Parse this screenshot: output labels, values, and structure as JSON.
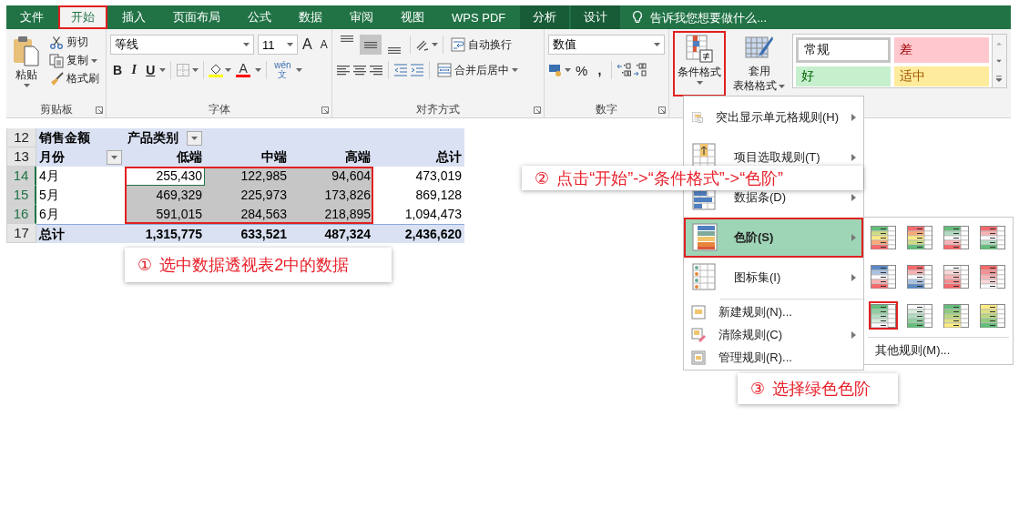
{
  "tabs": [
    {
      "label": "文件",
      "selected": false,
      "kind": "normal"
    },
    {
      "label": "开始",
      "selected": true,
      "kind": "normal"
    },
    {
      "label": "插入",
      "selected": false,
      "kind": "normal"
    },
    {
      "label": "页面布局",
      "selected": false,
      "kind": "normal"
    },
    {
      "label": "公式",
      "selected": false,
      "kind": "normal"
    },
    {
      "label": "数据",
      "selected": false,
      "kind": "normal"
    },
    {
      "label": "审阅",
      "selected": false,
      "kind": "normal"
    },
    {
      "label": "视图",
      "selected": false,
      "kind": "normal"
    },
    {
      "label": "WPS PDF",
      "selected": false,
      "kind": "normal"
    },
    {
      "label": "分析",
      "selected": false,
      "kind": "contextual"
    },
    {
      "label": "设计",
      "selected": false,
      "kind": "contextual"
    }
  ],
  "tell_me": {
    "placeholder": "告诉我您想要做什么..."
  },
  "ribbon": {
    "clipboard": {
      "label": "剪贴板",
      "paste": "粘贴",
      "cut": "剪切",
      "copy": "复制",
      "format_painter": "格式刷"
    },
    "font": {
      "label": "字体",
      "font_name": "等线",
      "font_size": "11",
      "grow": "A",
      "shrink": "A",
      "bold": "B",
      "italic": "I",
      "underline": "U",
      "font_color": "A",
      "phonetic_top": "wén",
      "phonetic_bottom": "文"
    },
    "alignment": {
      "label": "对齐方式",
      "vertical_align": [
        {
          "selected": false
        },
        {
          "selected": true
        },
        {
          "selected": false
        }
      ],
      "wrap_text": "自动换行",
      "merge_center": "合并后居中"
    },
    "number": {
      "label": "数字",
      "format": "数值",
      "percent": "%",
      "comma": ","
    },
    "styles": {
      "conditional_formatting": {
        "label": "条件格式",
        "selected": true
      },
      "format_as_table": {
        "line_1": "套用",
        "line_2": "表格格式"
      },
      "cell_styles": [
        {
          "label": "常规",
          "kind": "normal"
        },
        {
          "label": "差",
          "kind": "bad"
        },
        {
          "label": "好",
          "kind": "good"
        },
        {
          "label": "适中",
          "kind": "neutral"
        }
      ]
    }
  },
  "sheet": {
    "rows": [
      {
        "number": "12",
        "selected": false,
        "kind": "header",
        "cells": [
          {
            "text": "销售金额",
            "kind": "title",
            "selected": false,
            "active": false
          },
          {
            "text": "产品类别",
            "kind": "filter",
            "selected": false,
            "active": false
          }
        ]
      },
      {
        "number": "13",
        "selected": false,
        "kind": "header",
        "cells": [
          {
            "text": "月份",
            "kind": "filter",
            "selected": false,
            "active": false
          },
          {
            "text": "低端",
            "kind": "header",
            "selected": false,
            "active": false
          },
          {
            "text": "中端",
            "kind": "header",
            "selected": false,
            "active": false
          },
          {
            "text": "高端",
            "kind": "header",
            "selected": false,
            "active": false
          },
          {
            "text": "总计",
            "kind": "header",
            "selected": false,
            "active": false
          }
        ]
      },
      {
        "number": "14",
        "selected": true,
        "kind": "data",
        "cells": [
          {
            "text": "4月",
            "kind": "label",
            "selected": false,
            "active": false
          },
          {
            "text": "255,430",
            "kind": "number",
            "selected": true,
            "active": true
          },
          {
            "text": "122,985",
            "kind": "number",
            "selected": true,
            "active": false
          },
          {
            "text": "94,604",
            "kind": "number",
            "selected": true,
            "active": false
          },
          {
            "text": "473,019",
            "kind": "number",
            "selected": false,
            "active": false
          }
        ]
      },
      {
        "number": "15",
        "selected": true,
        "kind": "data",
        "cells": [
          {
            "text": "5月",
            "kind": "label",
            "selected": false,
            "active": false
          },
          {
            "text": "469,329",
            "kind": "number",
            "selected": true,
            "active": false
          },
          {
            "text": "225,973",
            "kind": "number",
            "selected": true,
            "active": false
          },
          {
            "text": "173,826",
            "kind": "number",
            "selected": true,
            "active": false
          },
          {
            "text": "869,128",
            "kind": "number",
            "selected": false,
            "active": false
          }
        ]
      },
      {
        "number": "16",
        "selected": true,
        "kind": "data",
        "cells": [
          {
            "text": "6月",
            "kind": "label",
            "selected": false,
            "active": false
          },
          {
            "text": "591,015",
            "kind": "number",
            "selected": true,
            "active": false
          },
          {
            "text": "284,563",
            "kind": "number",
            "selected": true,
            "active": false
          },
          {
            "text": "218,895",
            "kind": "number",
            "selected": true,
            "active": false
          },
          {
            "text": "1,094,473",
            "kind": "number",
            "selected": false,
            "active": false
          }
        ]
      },
      {
        "number": "17",
        "selected": false,
        "kind": "total",
        "cells": [
          {
            "text": "总计",
            "kind": "title",
            "selected": false,
            "active": false
          },
          {
            "text": "1,315,775",
            "kind": "total",
            "selected": false,
            "active": false
          },
          {
            "text": "633,521",
            "kind": "total",
            "selected": false,
            "active": false
          },
          {
            "text": "487,324",
            "kind": "total",
            "selected": false,
            "active": false
          },
          {
            "text": "2,436,620",
            "kind": "total",
            "selected": false,
            "active": false
          }
        ]
      }
    ]
  },
  "menu": {
    "items": [
      {
        "label": "突出显示单元格规则(H)",
        "kind": "large",
        "submenu": true,
        "selected": false
      },
      {
        "label": "项目选取规则(T)",
        "kind": "large",
        "submenu": true,
        "selected": false
      },
      {
        "label": "数据条(D)",
        "kind": "large",
        "submenu": true,
        "selected": false
      },
      {
        "label": "色阶(S)",
        "kind": "large",
        "submenu": true,
        "selected": true
      },
      {
        "label": "图标集(I)",
        "kind": "large",
        "submenu": true,
        "selected": false
      },
      {
        "label": "新建规则(N)...",
        "kind": "small",
        "submenu": false,
        "selected": false
      },
      {
        "label": "清除规则(C)",
        "kind": "small",
        "submenu": true,
        "selected": false
      },
      {
        "label": "管理规则(R)...",
        "kind": "small",
        "submenu": false,
        "selected": false
      }
    ],
    "color_scales": [
      {
        "selected": false
      },
      {
        "selected": false
      },
      {
        "selected": false
      },
      {
        "selected": false
      },
      {
        "selected": false
      },
      {
        "selected": false
      },
      {
        "selected": false
      },
      {
        "selected": false
      },
      {
        "selected": true
      },
      {
        "selected": false
      },
      {
        "selected": false
      },
      {
        "selected": false
      }
    ],
    "more_rules": "其他规则(M)..."
  },
  "callouts": [
    {
      "number": "①",
      "text": "选中数据透视表2中的数据"
    },
    {
      "number": "②",
      "text": "点击“开始”->“条件格式”->“色阶”"
    },
    {
      "number": "③",
      "text": "选择绿色色阶"
    }
  ]
}
